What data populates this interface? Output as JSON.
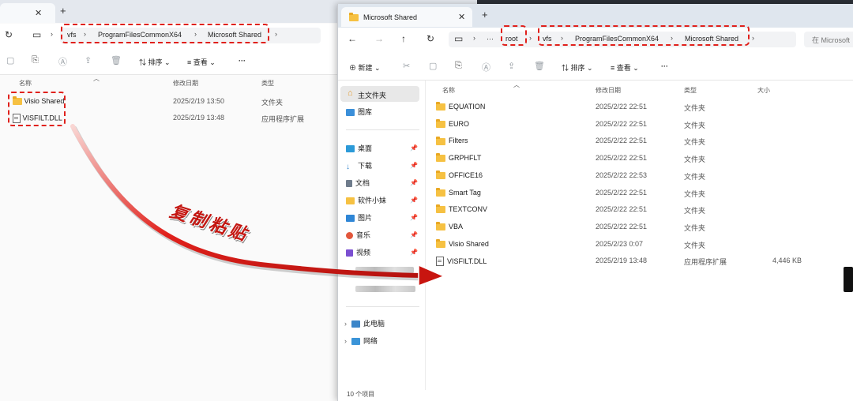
{
  "left_window": {
    "breadcrumbs": [
      "vfs",
      "ProgramFilesCommonX64",
      "Microsoft Shared"
    ],
    "toolbar": {
      "sort": "排序",
      "view": "查看",
      "more": "···"
    },
    "columns": {
      "name": "名称",
      "date": "修改日期",
      "type": "类型"
    },
    "files": [
      {
        "name": "Visio Shared",
        "date": "2025/2/19 13:50",
        "type": "文件夹",
        "icon": "folder-icon"
      },
      {
        "name": "VISFILT.DLL",
        "date": "2025/2/19 13:48",
        "type": "应用程序扩展",
        "icon": "file-icon"
      }
    ]
  },
  "right_window": {
    "tab_title": "Microsoft Shared",
    "breadcrumbs": [
      "root",
      "vfs",
      "ProgramFilesCommonX64",
      "Microsoft Shared"
    ],
    "search_placeholder": "在 Microsoft",
    "toolbar": {
      "new": "新建",
      "sort": "排序",
      "view": "查看",
      "more": "···"
    },
    "sidebar": {
      "top": [
        {
          "label": "主文件夹",
          "icon": "home-icon"
        },
        {
          "label": "图库",
          "icon": "gallery-icon"
        }
      ],
      "quick": [
        {
          "label": "桌面",
          "icon": "desktop-icon"
        },
        {
          "label": "下载",
          "icon": "download-icon"
        },
        {
          "label": "文档",
          "icon": "document-icon"
        },
        {
          "label": "软件小妹",
          "icon": "folder-icon"
        },
        {
          "label": "图片",
          "icon": "pictures-icon"
        },
        {
          "label": "音乐",
          "icon": "music-icon"
        },
        {
          "label": "视频",
          "icon": "video-icon"
        }
      ],
      "bottom": [
        {
          "label": "此电脑",
          "icon": "pc-icon"
        },
        {
          "label": "网络",
          "icon": "network-icon"
        }
      ]
    },
    "columns": {
      "name": "名称",
      "date": "修改日期",
      "type": "类型",
      "size": "大小"
    },
    "files": [
      {
        "name": "EQUATION",
        "date": "2025/2/22 22:51",
        "type": "文件夹",
        "size": ""
      },
      {
        "name": "EURO",
        "date": "2025/2/22 22:51",
        "type": "文件夹",
        "size": ""
      },
      {
        "name": "Filters",
        "date": "2025/2/22 22:51",
        "type": "文件夹",
        "size": ""
      },
      {
        "name": "GRPHFLT",
        "date": "2025/2/22 22:51",
        "type": "文件夹",
        "size": ""
      },
      {
        "name": "OFFICE16",
        "date": "2025/2/22 22:53",
        "type": "文件夹",
        "size": ""
      },
      {
        "name": "Smart Tag",
        "date": "2025/2/22 22:51",
        "type": "文件夹",
        "size": ""
      },
      {
        "name": "TEXTCONV",
        "date": "2025/2/22 22:51",
        "type": "文件夹",
        "size": ""
      },
      {
        "name": "VBA",
        "date": "2025/2/22 22:51",
        "type": "文件夹",
        "size": ""
      },
      {
        "name": "Visio Shared",
        "date": "2025/2/23 0:07",
        "type": "文件夹",
        "size": ""
      },
      {
        "name": "VISFILT.DLL",
        "date": "2025/2/19 13:48",
        "type": "应用程序扩展",
        "size": "4,446 KB"
      }
    ],
    "status": "10 个项目"
  },
  "annotation": {
    "text": "复制粘贴",
    "color": "#e0211c"
  }
}
